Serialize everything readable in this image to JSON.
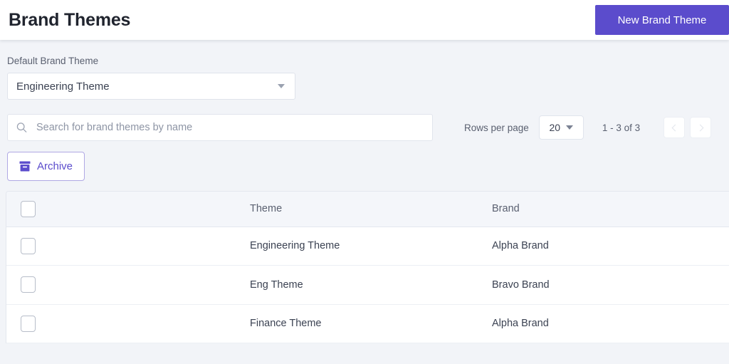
{
  "header": {
    "title": "Brand Themes",
    "new_button_label": "New Brand Theme",
    "accent_color": "#5b4ccc"
  },
  "default_theme": {
    "label": "Default Brand Theme",
    "selected_value": "Engineering Theme",
    "caret_icon": "chevron-down-icon"
  },
  "search": {
    "placeholder": "Search for brand themes by name",
    "value": "",
    "icon": "search-icon"
  },
  "pagination": {
    "rows_per_page_label": "Rows per page",
    "rows_per_page_value": "20",
    "range_text": "1 - 3 of 3",
    "prev_icon": "chevron-left-icon",
    "next_icon": "chevron-right-icon"
  },
  "actions": {
    "archive_label": "Archive",
    "archive_icon": "archive-box-icon",
    "archive_color": "#5b4ccc"
  },
  "table": {
    "columns": [
      "",
      "Theme",
      "Brand"
    ],
    "select_all_checkbox": "unchecked",
    "rows": [
      {
        "checkbox": "unchecked",
        "theme": "Engineering Theme",
        "brand": "Alpha Brand"
      },
      {
        "checkbox": "unchecked",
        "theme": "Eng Theme",
        "brand": "Bravo Brand"
      },
      {
        "checkbox": "unchecked",
        "theme": "Finance Theme",
        "brand": "Alpha Brand"
      }
    ]
  }
}
